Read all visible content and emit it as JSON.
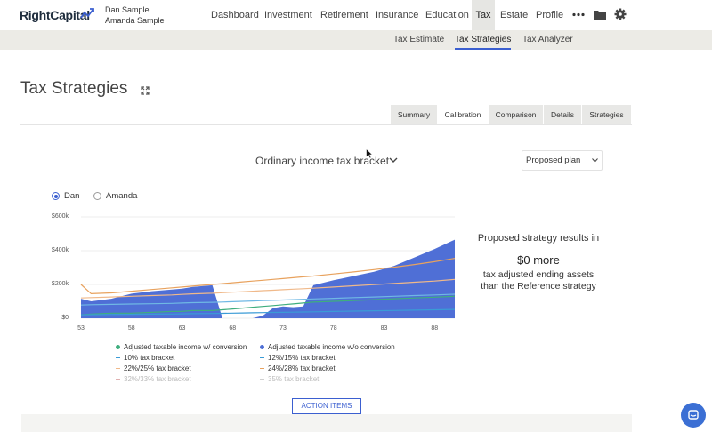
{
  "brand": {
    "logo_text": "RightCapital"
  },
  "users": {
    "primary": "Dan Sample",
    "secondary": "Amanda Sample"
  },
  "nav": {
    "items": [
      {
        "label": "Dashboard"
      },
      {
        "label": "Investment"
      },
      {
        "label": "Retirement"
      },
      {
        "label": "Insurance"
      },
      {
        "label": "Education"
      },
      {
        "label": "Tax",
        "active": true
      },
      {
        "label": "Estate"
      },
      {
        "label": "Profile"
      }
    ],
    "more_icon": "more-dots-icon",
    "folder_icon": "folder-icon",
    "settings_icon": "gear-icon"
  },
  "subnav": {
    "items": [
      {
        "label": "Tax Estimate"
      },
      {
        "label": "Tax Strategies",
        "active": true
      },
      {
        "label": "Tax Analyzer"
      }
    ]
  },
  "page": {
    "title": "Tax Strategies",
    "expand_icon": "expand-icon"
  },
  "tabs": [
    {
      "label": "Summary"
    },
    {
      "label": "Calibration",
      "active": true
    },
    {
      "label": "Comparison"
    },
    {
      "label": "Details"
    },
    {
      "label": "Strategies"
    }
  ],
  "chart_header": {
    "title": "Ordinary income tax bracket",
    "plan_select": "Proposed plan"
  },
  "radio": {
    "options": [
      {
        "label": "Dan",
        "checked": true
      },
      {
        "label": "Amanda",
        "checked": false
      }
    ]
  },
  "result": {
    "line1": "Proposed strategy results in",
    "line2": "$0 more",
    "line3": "tax adjusted ending assets",
    "line4": "than the Reference strategy"
  },
  "action_button": "ACTION ITEMS",
  "colors": {
    "accent": "#3b5fd0",
    "area": "#4f6fd6",
    "green": "#3fae7e",
    "orange": "#e8a25e",
    "light_orange": "#f0b98a"
  },
  "chart_data": {
    "type": "area",
    "x": [
      53,
      54,
      56,
      58,
      60,
      62,
      63,
      64,
      66,
      67,
      68,
      69,
      70,
      71,
      72,
      73,
      74,
      75,
      76,
      78,
      80,
      82,
      84,
      86,
      88,
      90
    ],
    "xticks": [
      53,
      58,
      63,
      68,
      73,
      78,
      83,
      88
    ],
    "ylabels": [
      "$600k",
      "$400k",
      "$200k",
      "$0"
    ],
    "ylim": [
      0,
      600000
    ],
    "series": [
      {
        "name": "Adjusted taxable income w/o conversion",
        "type": "area",
        "values": [
          115000,
          100000,
          115000,
          145000,
          160000,
          170000,
          175000,
          185000,
          195000,
          0,
          0,
          0,
          0,
          15000,
          60000,
          70000,
          65000,
          70000,
          195000,
          225000,
          250000,
          275000,
          310000,
          360000,
          410000,
          465000
        ]
      },
      {
        "name": "Adjusted taxable income w/ conversion",
        "type": "line",
        "values": [
          20000,
          25000,
          30000,
          30000,
          35000,
          40000,
          40000,
          45000,
          45000,
          50000,
          55000,
          60000,
          65000,
          70000,
          75000,
          80000,
          85000,
          90000,
          95000,
          100000,
          105000,
          110000,
          115000,
          120000,
          125000,
          130000
        ]
      },
      {
        "name": "10% tax bracket",
        "values": [
          20000,
          21000,
          22000,
          23000,
          24000,
          25000,
          26000,
          27000,
          28000,
          29000,
          30000,
          31000,
          32000,
          33000,
          34000,
          35000,
          36000,
          37000,
          38000,
          40000,
          42000,
          44000,
          46000,
          48000,
          50000,
          52000
        ]
      },
      {
        "name": "12%/15% tax bracket",
        "values": [
          78000,
          80000,
          82000,
          84000,
          86000,
          88000,
          90000,
          92000,
          94000,
          96000,
          98000,
          100000,
          102000,
          104000,
          106000,
          108000,
          110000,
          112000,
          114000,
          118000,
          122000,
          126000,
          130000,
          134000,
          138000,
          142000
        ]
      },
      {
        "name": "22%/25% tax bracket",
        "values": [
          120000,
          122000,
          126000,
          130000,
          134000,
          138000,
          141000,
          144000,
          148000,
          151000,
          154000,
          157000,
          160000,
          163000,
          166000,
          169000,
          172000,
          175000,
          178000,
          185000,
          192000,
          199000,
          206000,
          213000,
          220000,
          230000
        ]
      },
      {
        "name": "24%/28% tax bracket",
        "values": [
          200000,
          145000,
          150000,
          160000,
          170000,
          180000,
          185000,
          190000,
          200000,
          205000,
          210000,
          215000,
          220000,
          225000,
          230000,
          235000,
          240000,
          245000,
          250000,
          262000,
          274000,
          288000,
          302000,
          318000,
          335000,
          355000
        ]
      }
    ],
    "legend": [
      {
        "label": "Adjusted taxable income w/ conversion",
        "marker": "dot",
        "color": "#3fae7e"
      },
      {
        "label": "Adjusted taxable income w/o conversion",
        "marker": "dot",
        "color": "#4f6fd6"
      },
      {
        "label": "10% tax bracket",
        "marker": "line",
        "color": "#3a9bd6"
      },
      {
        "label": "12%/15% tax bracket",
        "marker": "line",
        "color": "#3a9bd6"
      },
      {
        "label": "22%/25% tax bracket",
        "marker": "line",
        "color": "#f0b98a"
      },
      {
        "label": "24%/28% tax bracket",
        "marker": "line",
        "color": "#e8a25e"
      },
      {
        "label": "32%/33% tax bracket",
        "marker": "line",
        "color": "#e0b0b0",
        "faded": true
      },
      {
        "label": "35% tax bracket",
        "marker": "line",
        "color": "#d0d0d0",
        "faded": true
      }
    ]
  }
}
